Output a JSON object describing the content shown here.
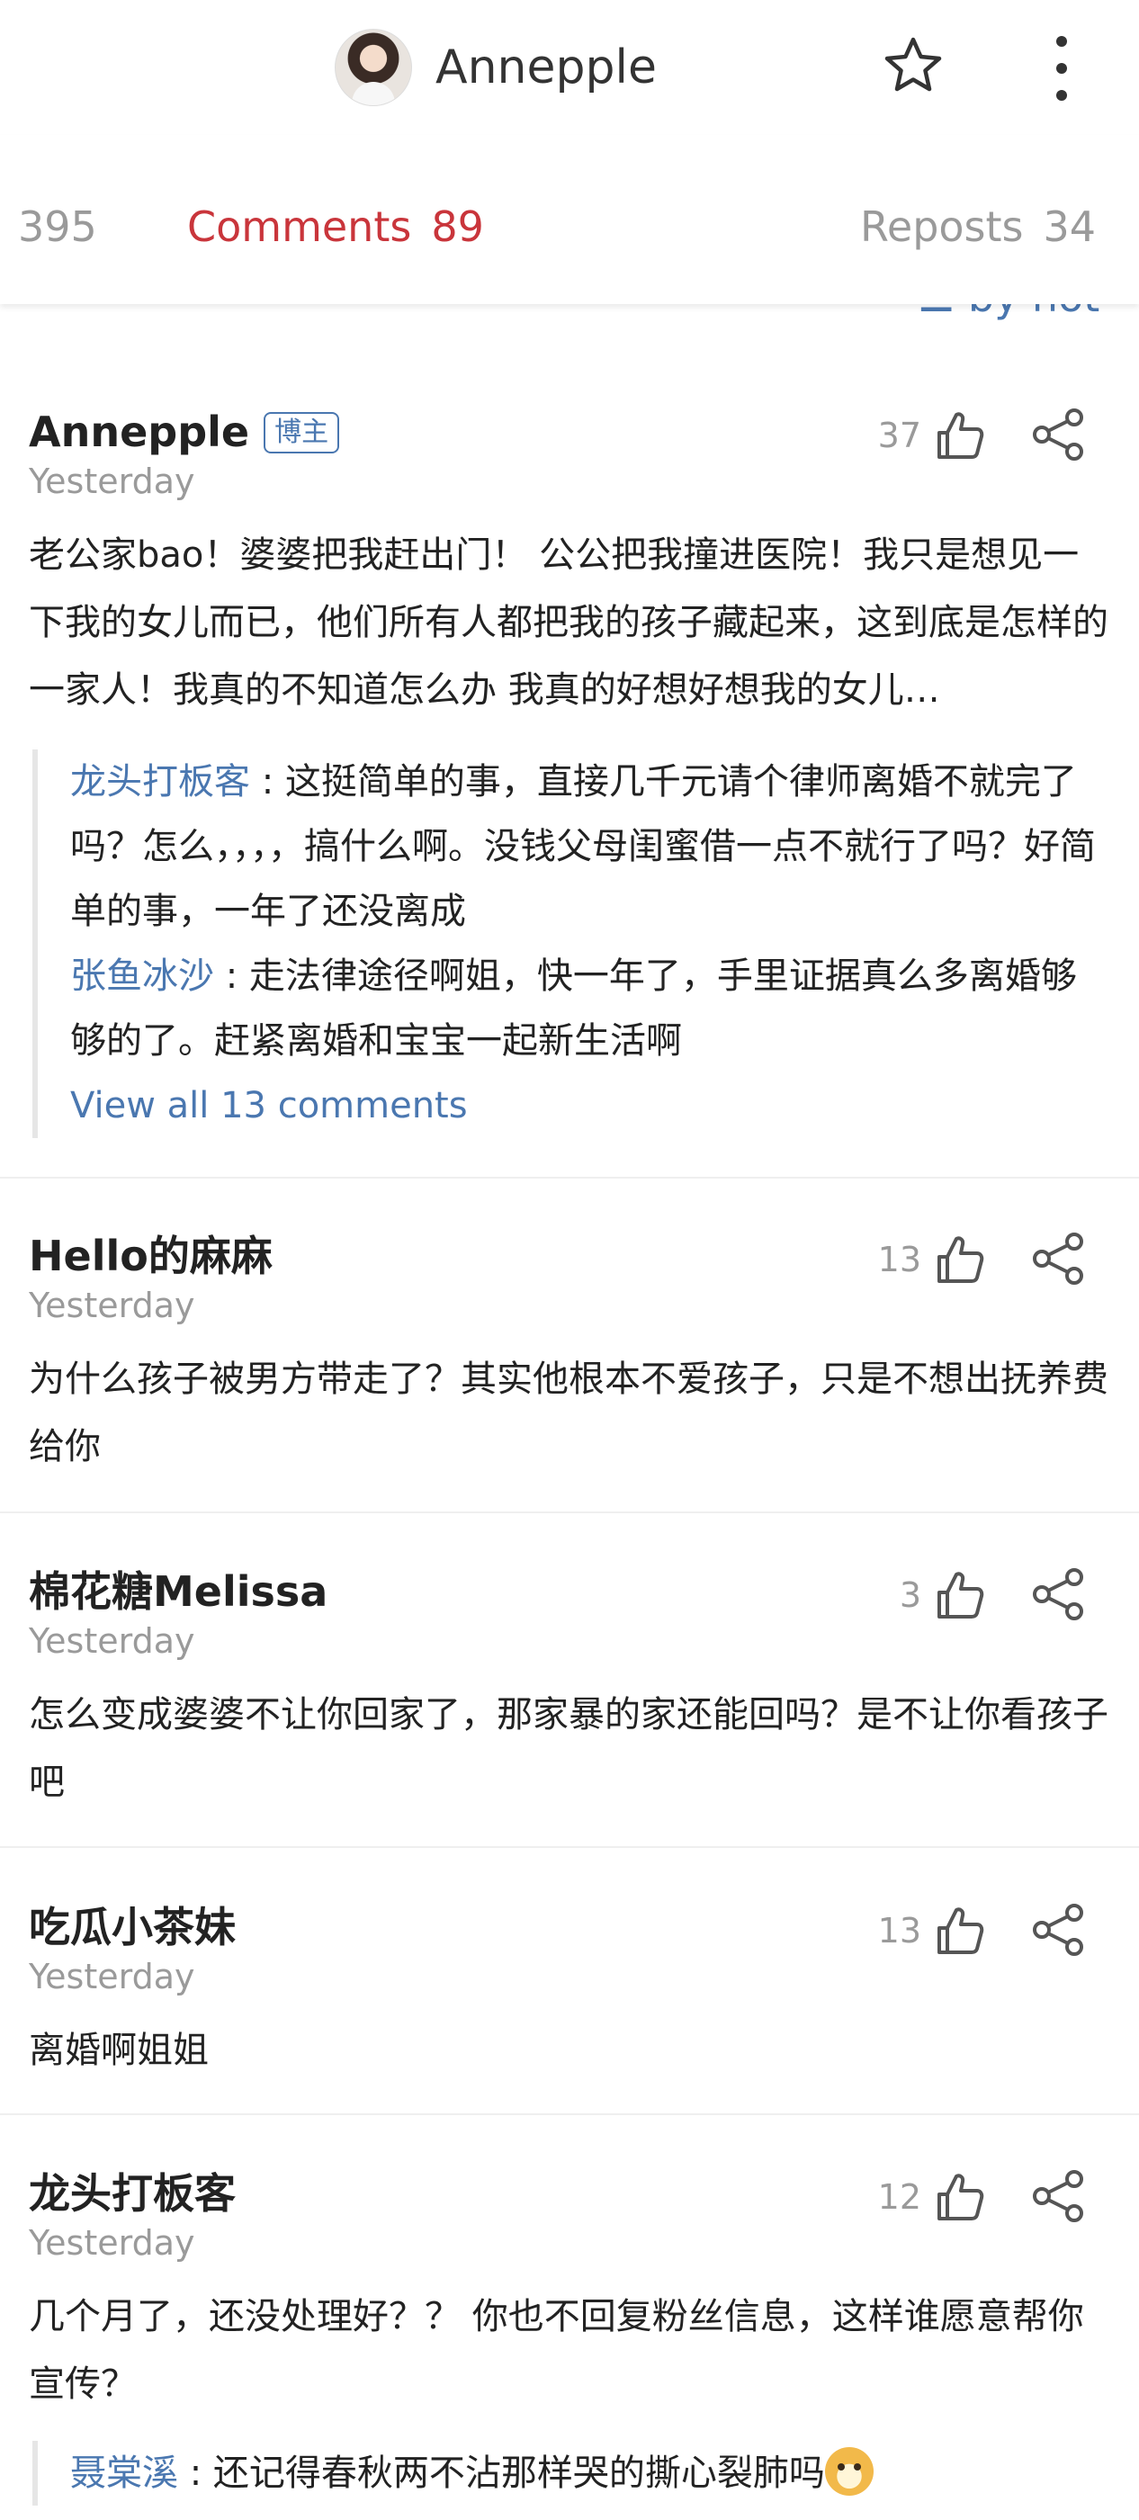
{
  "header": {
    "username": "Annepple",
    "icons": {
      "favorite": "star-outline-icon",
      "more": "vertical-ellipsis-icon"
    }
  },
  "tabs": [
    {
      "label": "",
      "count": "395",
      "active": false
    },
    {
      "label": "Comments",
      "count": "89",
      "active": true
    },
    {
      "label": "Reposts",
      "count": "34",
      "active": false
    }
  ],
  "sort": {
    "label": "by hot",
    "icon": "sort-icon"
  },
  "colors": {
    "accent": "#c9353b",
    "link": "#4a77b0",
    "muted": "#9a9a9a"
  },
  "comments": [
    {
      "author": "Annepple",
      "badge": "博主",
      "time": "Yesterday",
      "likes": "37",
      "text": "老公家bao！婆婆把我赶出门！ 公公把我撞进医院！我只是想见一下我的女儿而已，他们所有人都把我的孩子藏起来，这到底是怎样的一家人！我真的不知道怎么办 我真的好想好想我的女儿…",
      "replies": [
        {
          "name": "龙头打板客",
          "text": "这挺简单的事，直接几千元请个律师离婚不就完了吗？怎么，，，，搞什么啊。没钱父母闺蜜借一点不就行了吗？好简单的事，一年了还没离成"
        },
        {
          "name": "张鱼冰沙",
          "text": "走法律途径啊姐，快一年了，手里证据真么多离婚够够的了。赶紧离婚和宝宝一起新生活啊"
        }
      ],
      "view_all": "View all 13 comments"
    },
    {
      "author": "Hello的麻麻",
      "time": "Yesterday",
      "likes": "13",
      "text": "为什么孩子被男方带走了？其实他根本不爱孩子，只是不想出抚养费给你"
    },
    {
      "author": "棉花糖Melissa",
      "time": "Yesterday",
      "likes": "3",
      "text": "怎么变成婆婆不让你回家了，那家暴的家还能回吗？是不让你看孩子吧"
    },
    {
      "author": "吃瓜小茶妹",
      "time": "Yesterday",
      "likes": "13",
      "text": "离婚啊姐姐"
    },
    {
      "author": "龙头打板客",
      "time": "Yesterday",
      "likes": "12",
      "text": "几个月了，还没处理好？？ 你也不回复粉丝信息，这样谁愿意帮你宣传？",
      "replies": [
        {
          "name": "聂棠溪",
          "text": "还记得春秋两不沾那样哭的撕心裂肺吗",
          "emoji": "doge-emoji-icon"
        }
      ]
    }
  ]
}
